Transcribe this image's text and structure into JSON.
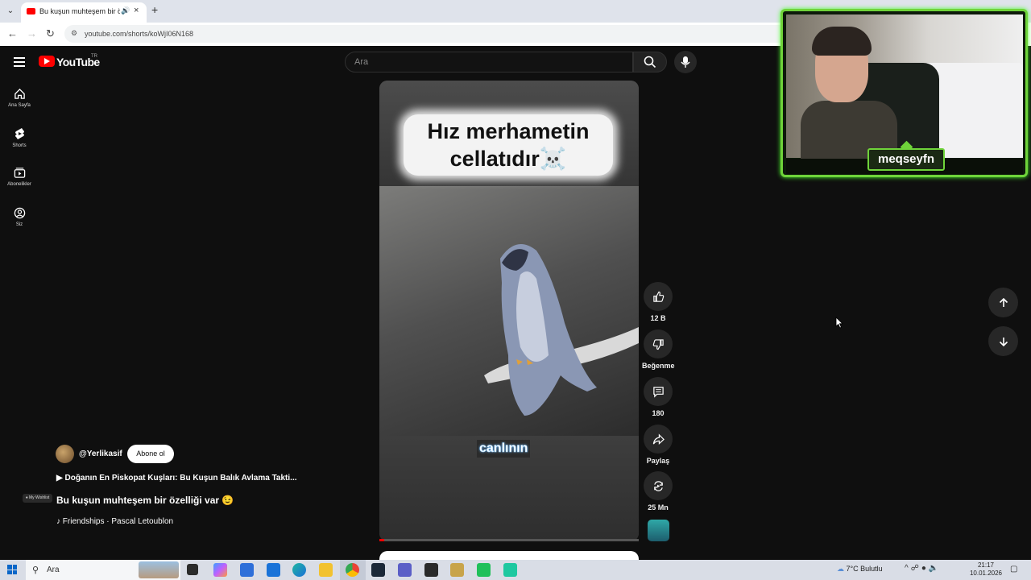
{
  "browser": {
    "tab_title": "Bu kuşun muhteşem bir özelliği var",
    "url": "youtube.com/shorts/koWjI06N168",
    "new_tab_symbol": "+",
    "close_symbol": "×"
  },
  "youtube": {
    "wordmark": "YouTube",
    "country": "TR",
    "search_placeholder": "Ara",
    "sidebar": [
      {
        "label": "Ana Sayfa",
        "icon": "home-icon"
      },
      {
        "label": "Shorts",
        "icon": "shorts-icon"
      },
      {
        "label": "Abonelikler",
        "icon": "subscriptions-icon"
      },
      {
        "label": "Siz",
        "icon": "you-icon"
      }
    ],
    "video": {
      "caption_top": "Hız merhametin cellatıdır☠️",
      "caption_mid": "canlının",
      "progress": 0.02
    },
    "actions": {
      "likes": "12 B",
      "dislike_label": "Beğenme",
      "comments": "180",
      "share_label": "Paylaş",
      "remix_label": "25 Mn"
    },
    "meta": {
      "channel": "@Yerlikasif",
      "subscribe_label": "Abone ol",
      "playlist": "Doğanın En Piskopat Kuşları: Bu Kuşun Balık Avlama Takti...",
      "title": "Bu kuşun muhteşem bir özelliği var 😉",
      "sound": "Friendships · Pascal Letoublon",
      "wishlist_badge": "My Wishlist"
    }
  },
  "webcam": {
    "name": "meqseyfn",
    "accent": "#6fd43a"
  },
  "taskbar": {
    "search_text": "Ara",
    "weather": "7°C Bulutlu",
    "time": "21:17",
    "date": "10.01.2026",
    "apps": [
      "task-view",
      "copilot",
      "store",
      "mail",
      "edge",
      "explorer",
      "chrome",
      "steam",
      "teams",
      "epic-games",
      "league-of-legends",
      "excel-green",
      "discord"
    ]
  },
  "colors": {
    "youtube_red": "#ff0000",
    "page_bg": "#0f0f0f",
    "button_bg": "#272727"
  }
}
